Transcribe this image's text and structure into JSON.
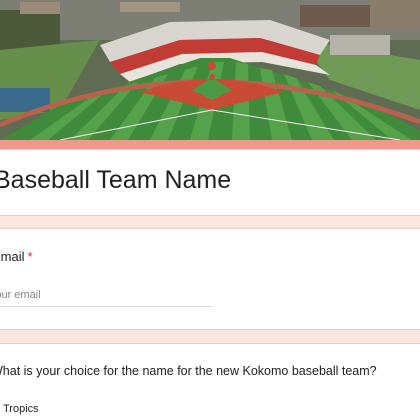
{
  "header": {
    "image_icon": "stadium-aerial-photo"
  },
  "form": {
    "title": "Baseball Team Name"
  },
  "email_question": {
    "label": "Email",
    "required_mark": "*",
    "placeholder": "Your email"
  },
  "choice_question": {
    "prompt": "What is your choice for the name for the new Kokomo baseball team?",
    "options": [
      {
        "label": "Tropics",
        "icon": "radio-icon"
      }
    ]
  },
  "colors": {
    "accent": "#ed9a8b",
    "background": "#fbe6e2",
    "required": "#d93025",
    "infield": "#c94a35"
  }
}
